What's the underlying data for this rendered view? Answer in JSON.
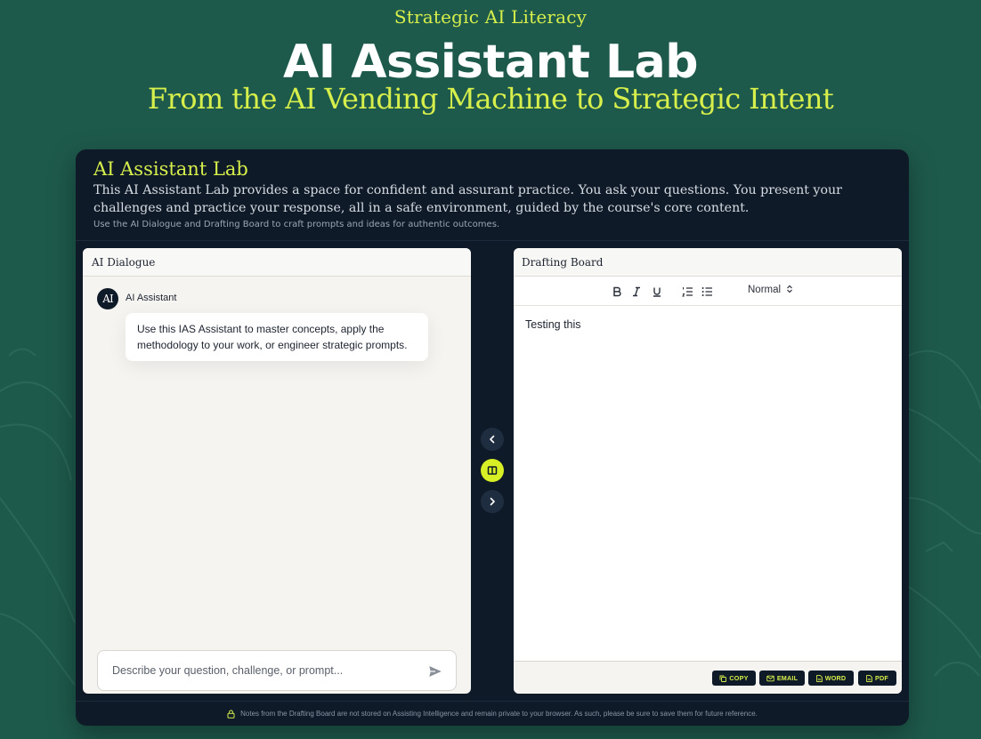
{
  "hero": {
    "eyebrow": "Strategic AI Literacy",
    "title": "AI Assistant Lab",
    "subtitle": "From the AI Vending Machine to Strategic Intent"
  },
  "card": {
    "title": "AI Assistant Lab",
    "description": "This AI Assistant Lab provides a space for confident and assurant practice. You ask your questions. You present your challenges and practice your response, all in a safe environment, guided by the course's core content.",
    "hint": "Use the AI Dialogue and Drafting Board to craft prompts and ideas for authentic outcomes.",
    "footer_note": "Notes from the Drafting Board are not stored on Assisting Intelligence and remain private to your browser. As such, please be sure to save them for future reference."
  },
  "dialogue": {
    "title": "AI Dialogue",
    "avatar_text": "AI",
    "sender": "AI Assistant",
    "message": "Use this IAS Assistant to master concepts, apply the methodology to your work, or engineer strategic prompts.",
    "input_placeholder": "Describe your question, challenge, or prompt..."
  },
  "rail": {
    "icons": [
      "chevron-left-icon",
      "columns-icon",
      "chevron-right-icon"
    ]
  },
  "drafting": {
    "title": "Drafting Board",
    "format_value": "Normal",
    "content": "Testing this",
    "exports": {
      "copy": "COPY",
      "email": "EMAIL",
      "word": "WORD",
      "pdf": "PDF"
    }
  },
  "colors": {
    "background": "#1e5a4c",
    "accent": "#d7ef4b",
    "card": "#0f1a28"
  }
}
